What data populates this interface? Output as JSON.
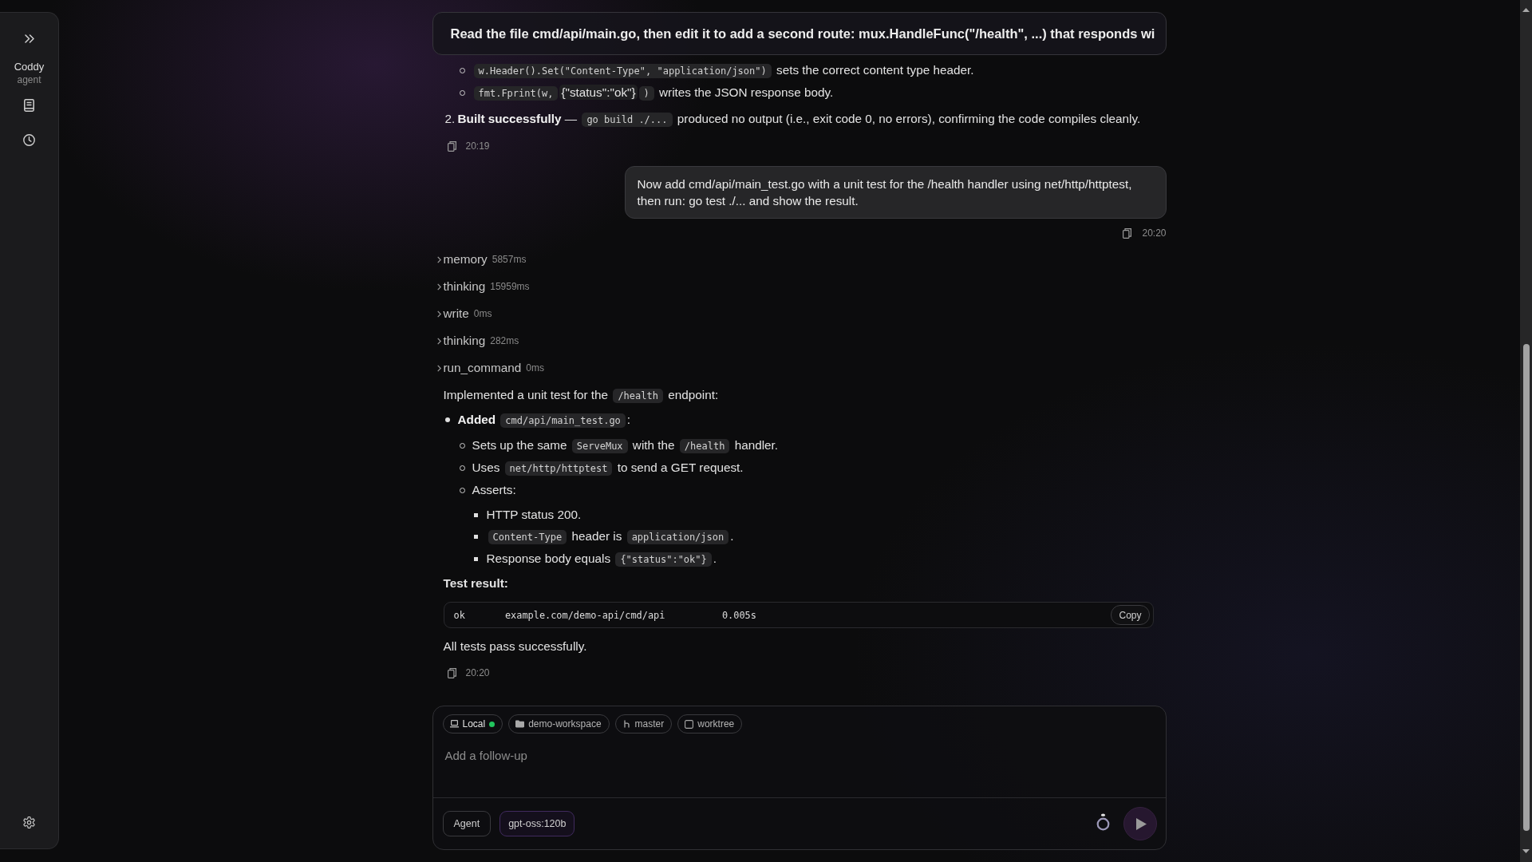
{
  "sidebar": {
    "app_name": "Coddy",
    "app_subtitle": "agent"
  },
  "pinned_prompt": "Read the file cmd/api/main.go, then edit it to add a second route: mux.HandleFunc(\"/health\", ...) that responds wi",
  "messages": [
    {
      "kind": "assistant",
      "blocks": [
        {
          "kind": "list",
          "items": [
            {
              "children": [
                {
                  "segments": [
                    {
                      "kind": "code",
                      "text": "w.Header().Set(\"Content-Type\", \"application/json\")"
                    },
                    {
                      "kind": "text",
                      "text": " sets the correct content type header."
                    }
                  ]
                },
                {
                  "segments": [
                    {
                      "kind": "code",
                      "text": "fmt.Fprint(w,"
                    },
                    {
                      "kind": "code_sans",
                      "text": "{\"status\":\"ok\"}"
                    },
                    {
                      "kind": "code",
                      "text": ")"
                    },
                    {
                      "kind": "text",
                      "text": " writes the JSON response body."
                    }
                  ]
                }
              ]
            },
            {
              "number": "2.",
              "segments": [
                {
                  "kind": "bold",
                  "text": "Built successfully"
                },
                {
                  "kind": "text",
                  "text": " — "
                },
                {
                  "kind": "code",
                  "text": "go build ./..."
                },
                {
                  "kind": "text",
                  "text": " produced no output (i.e., exit code 0, no errors), confirming the code compiles cleanly."
                }
              ]
            }
          ]
        }
      ],
      "time": "20:19"
    },
    {
      "kind": "user",
      "text": "Now add cmd/api/main_test.go with a unit test for the /health handler using net/http/httptest, then run: go test ./... and show the result.",
      "time": "20:20"
    },
    {
      "kind": "assistant",
      "tool_calls": [
        {
          "name": "memory",
          "duration": "5857ms",
          "expanded": false
        },
        {
          "name": "thinking",
          "duration": "15959ms",
          "expanded": false
        },
        {
          "name": "write",
          "duration": "0ms",
          "expanded": false
        },
        {
          "name": "thinking",
          "duration": "282ms",
          "expanded": false
        },
        {
          "name": "run_command",
          "duration": "0ms",
          "expanded": false
        }
      ],
      "blocks": [
        {
          "kind": "paragraph",
          "segments": [
            {
              "kind": "text",
              "text": "Implemented a unit test for the "
            },
            {
              "kind": "code",
              "text": "/health"
            },
            {
              "kind": "text",
              "text": " endpoint:"
            }
          ]
        },
        {
          "kind": "list",
          "items": [
            {
              "segments": [
                {
                  "kind": "bold",
                  "text": "Added "
                },
                {
                  "kind": "code",
                  "text": "cmd/api/main_test.go"
                },
                {
                  "kind": "text",
                  "text": ":"
                }
              ],
              "children": [
                {
                  "segments": [
                    {
                      "kind": "text",
                      "text": "Sets up the same "
                    },
                    {
                      "kind": "code",
                      "text": "ServeMux"
                    },
                    {
                      "kind": "text",
                      "text": " with the "
                    },
                    {
                      "kind": "code",
                      "text": "/health"
                    },
                    {
                      "kind": "text",
                      "text": " handler."
                    }
                  ]
                },
                {
                  "segments": [
                    {
                      "kind": "text",
                      "text": "Uses "
                    },
                    {
                      "kind": "code",
                      "text": "net/http/httptest"
                    },
                    {
                      "kind": "text",
                      "text": " to send a GET request."
                    }
                  ]
                },
                {
                  "segments": [
                    {
                      "kind": "text",
                      "text": "Asserts:"
                    }
                  ],
                  "children": [
                    {
                      "segments": [
                        {
                          "kind": "text",
                          "text": "HTTP status 200."
                        }
                      ]
                    },
                    {
                      "segments": [
                        {
                          "kind": "code",
                          "text": "Content-Type"
                        },
                        {
                          "kind": "text",
                          "text": " header is "
                        },
                        {
                          "kind": "code",
                          "text": "application/json"
                        },
                        {
                          "kind": "text",
                          "text": "."
                        }
                      ]
                    },
                    {
                      "segments": [
                        {
                          "kind": "text",
                          "text": "Response body equals "
                        },
                        {
                          "kind": "code",
                          "text": "{\"status\":\"ok\"}"
                        },
                        {
                          "kind": "text",
                          "text": "."
                        }
                      ]
                    }
                  ]
                }
              ]
            }
          ]
        },
        {
          "kind": "label",
          "text": "Test result:"
        },
        {
          "kind": "code_block",
          "text": "ok       example.com/demo-api/cmd/api          0.005s",
          "copy_label": "Copy"
        },
        {
          "kind": "paragraph",
          "segments": [
            {
              "kind": "text",
              "text": "All tests pass successfully."
            }
          ]
        }
      ],
      "time": "20:20"
    }
  ],
  "composer": {
    "chips": [
      {
        "kind": "location",
        "label": "Local",
        "color": "#22c55e"
      },
      {
        "kind": "folder",
        "label": "demo-workspace"
      },
      {
        "kind": "branch",
        "label": "master"
      },
      {
        "kind": "checkbox",
        "label": "worktree",
        "checked": false
      }
    ],
    "placeholder": "Add a follow-up",
    "mode": "Agent",
    "model": "gpt-oss:120b"
  }
}
